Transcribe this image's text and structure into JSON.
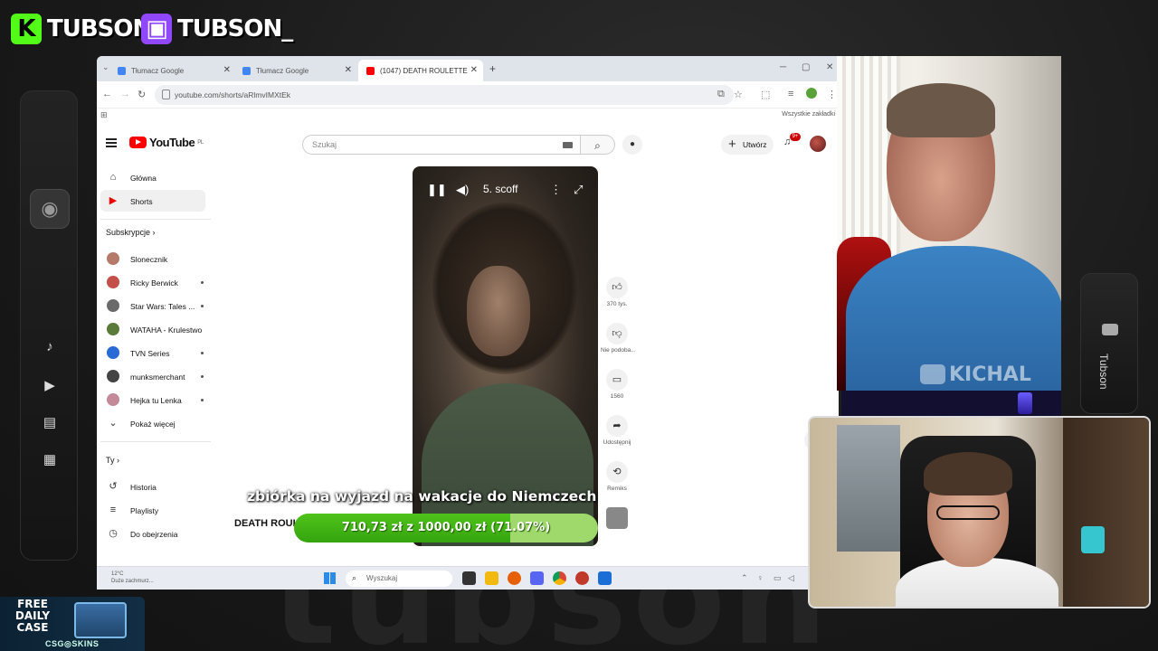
{
  "overlay": {
    "kick_name": "TUBSON",
    "twitch_name": "TUBSON_",
    "right_rail_name": "Tubson",
    "promo": {
      "line1": "FREE",
      "line2": "DAILY",
      "line3": "CASE",
      "sponsor": "CSG◎SKINS"
    },
    "background_word": "tubson"
  },
  "browser": {
    "tabs": [
      {
        "title": "Tłumacz Google",
        "active": false
      },
      {
        "title": "Tłumacz Google",
        "active": false
      },
      {
        "title": "(1047) DEATH ROULETTE",
        "active": true
      }
    ],
    "url": "youtube.com/shorts/aRlmvIMXtEk",
    "bookmarks_label": "Wszystkie zakładki"
  },
  "youtube": {
    "logo_text": "YouTube",
    "logo_country": "PL",
    "search_placeholder": "Szukaj",
    "create_label": "Utwórz",
    "notification_count": "9+",
    "sidebar": {
      "main": [
        {
          "label": "Główna",
          "icon": "home-icon"
        },
        {
          "label": "Shorts",
          "icon": "shorts-icon",
          "active": true
        }
      ],
      "subscriptions_header": "Subskrypcje",
      "subscriptions": [
        {
          "label": "Slonecznik",
          "color": "#b57a6a",
          "live": false
        },
        {
          "label": "Ricky Berwick",
          "color": "#c4504a",
          "live": true
        },
        {
          "label": "Star Wars: Tales ...",
          "color": "#6a6a6a",
          "live": true
        },
        {
          "label": "WATAHA - Krulestwo",
          "color": "#5a7a3a",
          "live": false
        },
        {
          "label": "TVN Series",
          "color": "#2a6ad4",
          "live": true
        },
        {
          "label": "munksmerchant",
          "color": "#444444",
          "live": true
        },
        {
          "label": "Hejka tu Lenka",
          "color": "#c48a9a",
          "live": true
        }
      ],
      "show_more": "Pokaż więcej",
      "you_header": "Ty",
      "you_items": [
        {
          "label": "Historia",
          "icon": "history-icon"
        },
        {
          "label": "Playlisty",
          "icon": "playlist-icon"
        },
        {
          "label": "Do obejrzenia",
          "icon": "watch-later-icon"
        }
      ]
    },
    "short": {
      "overlay_title": "5. scoff",
      "video_title": "DEATH ROUL",
      "caption": "zbiórka na wyjazd na wakacje do Niemczech",
      "likes": "370 tys.",
      "dislike_label": "Nie podoba...",
      "comments": "1560",
      "share_label": "Udostępnij",
      "remix_label": "Remiks"
    }
  },
  "donation_goal": {
    "text": "710,73 zł z 1000,00 zł (71.07%)",
    "progress": 0.7107
  },
  "taskbar": {
    "weather_temp": "12°C",
    "weather_desc": "Duże zachmurz...",
    "search_placeholder": "Wyszukaj"
  },
  "webcam_watermark": "KICHAL"
}
